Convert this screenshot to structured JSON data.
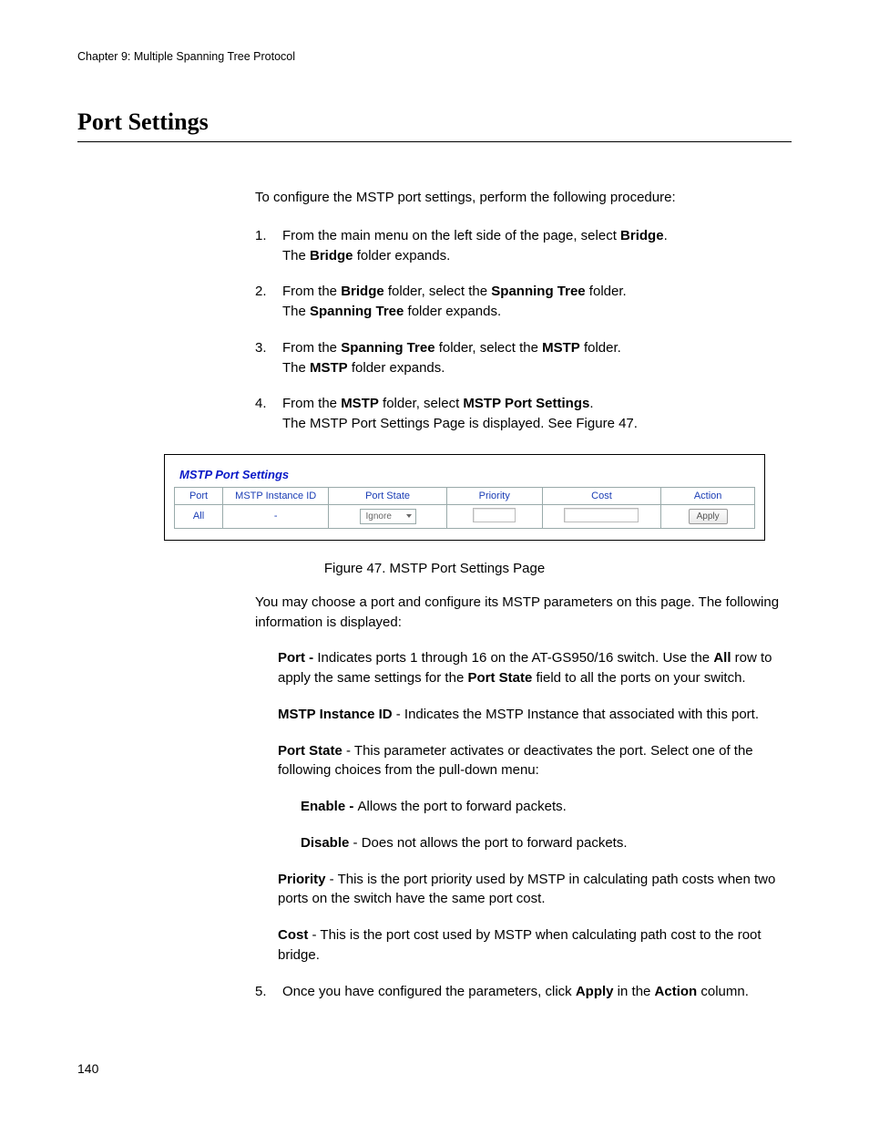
{
  "header": {
    "chapter": "Chapter 9: Multiple Spanning Tree Protocol"
  },
  "section": {
    "title": "Port Settings"
  },
  "intro": "To configure the MSTP port settings, perform the following procedure:",
  "steps": {
    "s1": {
      "num": "1.",
      "l1_a": "From the main menu on the left side of the page, select ",
      "l1_b": "Bridge",
      "l1_c": ".",
      "l2_a": "The ",
      "l2_b": "Bridge",
      "l2_c": " folder expands."
    },
    "s2": {
      "num": "2.",
      "l1_a": "From the ",
      "l1_b": "Bridge",
      "l1_c": " folder, select the ",
      "l1_d": "Spanning Tree",
      "l1_e": " folder.",
      "l2_a": "The ",
      "l2_b": "Spanning Tree",
      "l2_c": " folder expands."
    },
    "s3": {
      "num": "3.",
      "l1_a": "From the ",
      "l1_b": "Spanning Tree",
      "l1_c": " folder, select the ",
      "l1_d": "MSTP",
      "l1_e": " folder.",
      "l2_a": "The ",
      "l2_b": "MSTP",
      "l2_c": " folder expands."
    },
    "s4": {
      "num": "4.",
      "l1_a": "From the ",
      "l1_b": "MSTP",
      "l1_c": " folder, select ",
      "l1_d": "MSTP Port Settings",
      "l1_e": ".",
      "l2": "The MSTP Port Settings Page is displayed. See Figure 47."
    },
    "s5": {
      "num": "5.",
      "a": "Once you have configured the parameters, click ",
      "b": "Apply",
      "c": " in the ",
      "d": "Action",
      "e": " column."
    }
  },
  "figure": {
    "title": "MSTP Port Settings",
    "headers": {
      "port": "Port",
      "instance": "MSTP Instance ID",
      "state": "Port State",
      "priority": "Priority",
      "cost": "Cost",
      "action": "Action"
    },
    "row": {
      "port": "All",
      "instance": "-",
      "state_select": "Ignore",
      "action_button": "Apply"
    },
    "caption": "Figure 47. MSTP Port Settings Page"
  },
  "after": {
    "p1": "You may choose a port and configure its MSTP parameters on this page. The following information is displayed:",
    "port": {
      "a": "Port - ",
      "b": "Indicates ports 1 through 16 on the AT-GS950/16 switch. Use the ",
      "c": "All",
      "d": " row to apply the same settings for the ",
      "e": "Port State",
      "f": " field to all the ports on your switch."
    },
    "instance": {
      "a": "MSTP Instance ID",
      "b": " - Indicates the MSTP Instance that associated with this port."
    },
    "state": {
      "a": "Port State",
      "b": " - This parameter activates or deactivates the port. Select one of the following choices from the pull-down menu:"
    },
    "enable": {
      "a": "Enable - ",
      "b": "Allows the port to forward packets."
    },
    "disable": {
      "a": "Disable",
      "b": " - Does not allows the port to forward packets."
    },
    "priority": {
      "a": "Priority",
      "b": " - This is the port priority used by MSTP in calculating path costs when two ports on the switch have the same port cost."
    },
    "cost": {
      "a": "Cost",
      "b": " - This is the port cost used by MSTP when calculating path cost to the root bridge."
    }
  },
  "footer": {
    "page_number": "140"
  }
}
